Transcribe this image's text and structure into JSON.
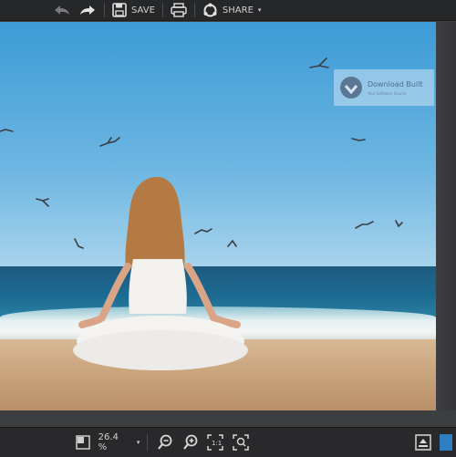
{
  "toolbar": {
    "undo_icon": "undo-arrow-icon",
    "redo_icon": "redo-arrow-icon",
    "save_label": "SAVE",
    "print_icon": "printer-icon",
    "share_label": "SHARE"
  },
  "watermark": {
    "title": "Download Built",
    "subtitle": "Your Software Source"
  },
  "statusbar": {
    "zoom_value": "26.4 %",
    "icons": [
      "fit-view-icon",
      "zoom-out-icon",
      "zoom-in-icon",
      "actual-size-icon",
      "fit-screen-icon",
      "export-icon",
      "panel-icon"
    ]
  },
  "colors": {
    "toolbar_bg": "#262729",
    "workspace_bg": "#3d3e40",
    "accent_blue": "#2d7fc1"
  }
}
